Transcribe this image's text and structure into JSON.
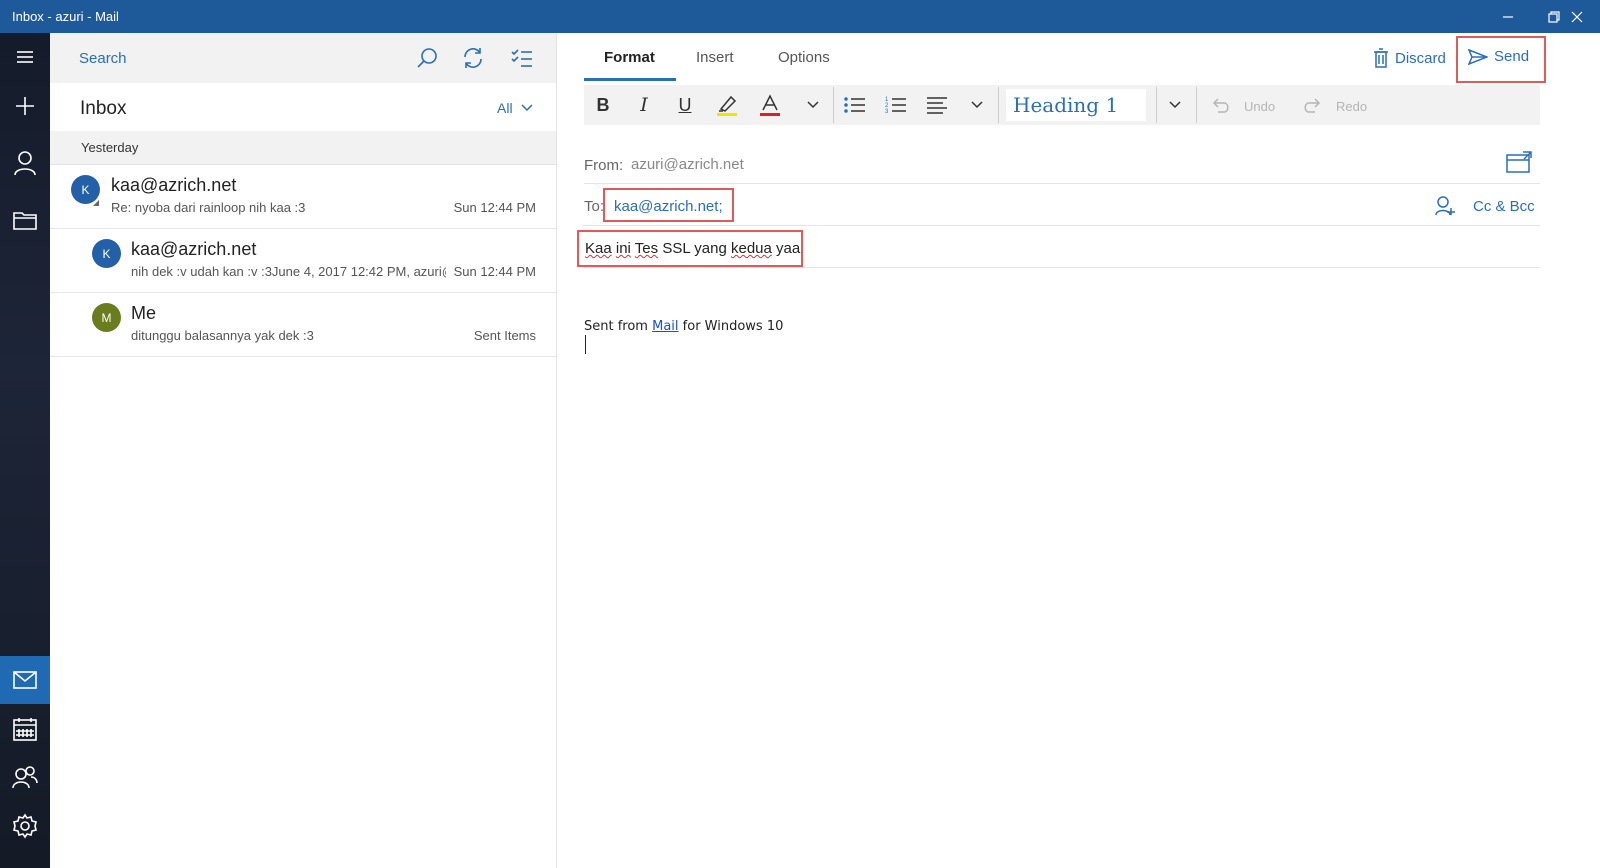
{
  "window": {
    "title": "Inbox - azuri - Mail"
  },
  "rail": {
    "items": [
      "hamburger-menu",
      "new-mail",
      "accounts",
      "folders",
      "mail",
      "calendar",
      "people",
      "settings"
    ]
  },
  "list": {
    "search_label": "Search",
    "folder_title": "Inbox",
    "filter_label": "All",
    "group_label": "Yesterday",
    "messages": [
      {
        "initial": "K",
        "avatar_color": "#2460a8",
        "sender": "kaa@azrich.net",
        "preview": "Re: nyoba dari rainloop nih kaa :3",
        "time": "Sun 12:44 PM"
      },
      {
        "initial": "K",
        "avatar_color": "#2460a8",
        "sender": "kaa@azrich.net",
        "preview": "nih dek :v udah kan :v :3June 4, 2017 12:42 PM, azuri@",
        "time": "Sun 12:44 PM"
      },
      {
        "initial": "M",
        "avatar_color": "#6a7d1e",
        "sender": "Me",
        "preview": "ditunggu balasannya yak dek :3",
        "time": "Sent Items"
      }
    ]
  },
  "compose": {
    "tabs": [
      "Format",
      "Insert",
      "Options"
    ],
    "discard_label": "Discard",
    "send_label": "Send",
    "toolbar": {
      "style_value": "Heading 1",
      "undo_label": "Undo",
      "redo_label": "Redo"
    },
    "from_label": "From:",
    "from_value": "azuri@azrich.net",
    "to_label": "To:",
    "to_value": "kaa@azrich.net;",
    "ccbcc_label": "Cc & Bcc",
    "subject_words": [
      "Kaa",
      "ini",
      "Tes",
      "SSL",
      "yang",
      "kedua",
      "yaa"
    ],
    "signature_prefix": "Sent from",
    "signature_link": "Mail",
    "signature_suffix": "for Windows 10"
  },
  "colors": {
    "accent": "#2a6fb5",
    "titlebar": "#1e5a9a",
    "highlight_box": "#e05a5a"
  }
}
